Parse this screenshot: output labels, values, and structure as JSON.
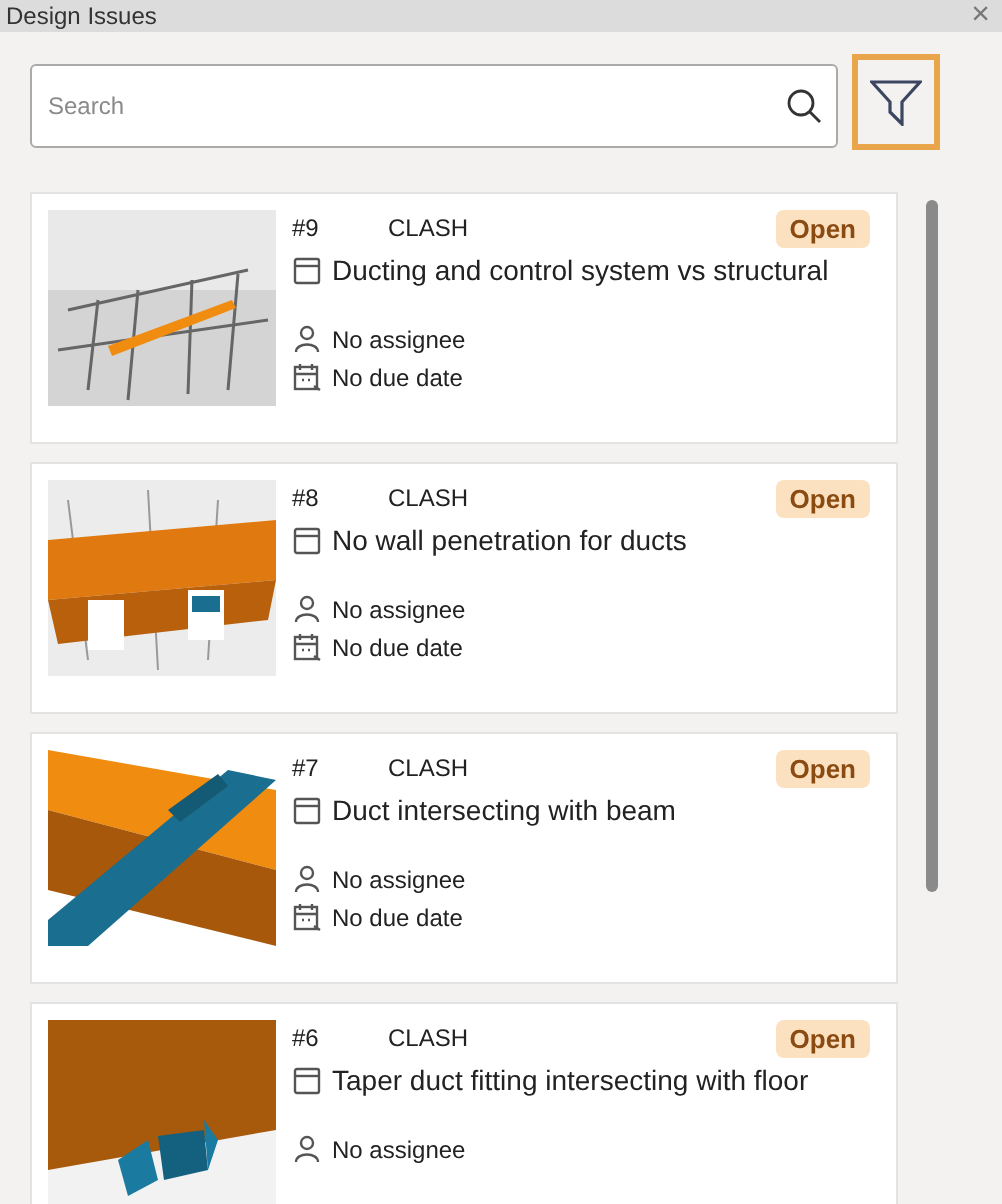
{
  "window": {
    "title": "Design Issues",
    "close": "×"
  },
  "search": {
    "placeholder": "Search"
  },
  "issues": [
    {
      "number": "#9",
      "type": "CLASH",
      "status": "Open",
      "title": "Ducting and control system vs structural",
      "assignee": "No assignee",
      "due": "No due date"
    },
    {
      "number": "#8",
      "type": "CLASH",
      "status": "Open",
      "title": "No wall penetration for ducts",
      "assignee": "No assignee",
      "due": "No due date"
    },
    {
      "number": "#7",
      "type": "CLASH",
      "status": "Open",
      "title": "Duct intersecting with beam",
      "assignee": "No assignee",
      "due": "No due date"
    },
    {
      "number": "#6",
      "type": "CLASH",
      "status": "Open",
      "title": "Taper duct fitting intersecting with floor",
      "assignee": "No assignee"
    }
  ]
}
